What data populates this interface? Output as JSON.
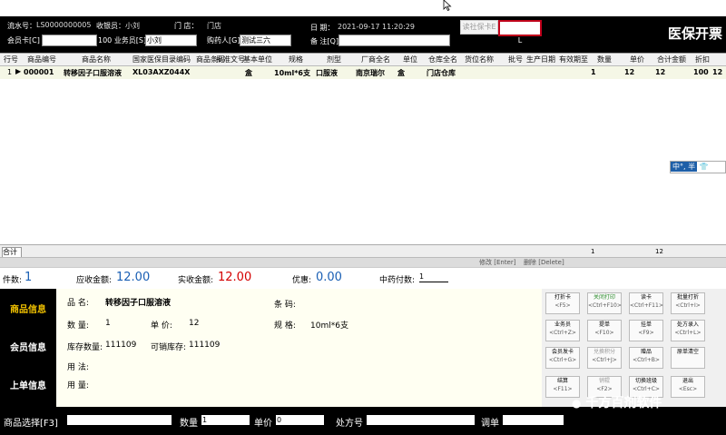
{
  "header": {
    "serial_label": "流水号：",
    "serial_value": "LS0000000005",
    "cashier_label": "收银员：",
    "cashier_value": "小刘",
    "store_label": "门  店：",
    "store_value": "门店",
    "date_label": "日  期：",
    "date_value": "2021-09-17 11:20:29",
    "member_label": "会员卡[C]",
    "member_value": "",
    "staff_label": "100 业务员[S]",
    "staff_value": "小刘",
    "buyer_label": "购药人[G]",
    "buyer_value": "测试三六",
    "note_label": "备  注[Q]",
    "note_value": "",
    "read_card_btn": "读社保卡E",
    "clear_card_btn": "清除社保卡L",
    "page_title": "医保开票"
  },
  "grid": {
    "columns": [
      "行号",
      "商品编号",
      "商品名称",
      "国家医保目录编码",
      "商品条码",
      "批准文号",
      "基本单位",
      "规格",
      "剂型",
      "厂商全名",
      "单位",
      "仓库全名",
      "货位名称",
      "批号",
      "生产日期",
      "有效期至",
      "数量",
      "单价",
      "合计金额",
      "折扣"
    ],
    "rows": [
      {
        "line": "1",
        "code": "000001",
        "name": "转移因子口服溶液",
        "insurance_code": "XL03AXZ044X",
        "unit_basic": "盒",
        "spec": "10ml*6支",
        "form": "口服液",
        "maker": "南京瑞尔",
        "unit": "盒",
        "warehouse": "门店仓库",
        "qty": "1",
        "price": "12",
        "total": "12",
        "discount": "100",
        "extra": "12"
      }
    ],
    "sum_label": "合计",
    "sum_qty": "1",
    "sum_total": "12",
    "modify_label": "修改 [Enter]",
    "delete_label": "删除 [Delete]",
    "ime_text": "中°, 半"
  },
  "totals": {
    "count_label": "件数:",
    "count_value": "1",
    "receivable_label": "应收金额:",
    "receivable_value": "12.00",
    "received_label": "实收金额:",
    "received_value": "12.00",
    "discount_label": "优惠:",
    "discount_value": "0.00",
    "herb_label": "中药付数:",
    "herb_value": "1"
  },
  "side_tabs": [
    "商品信息",
    "会员信息",
    "上单信息"
  ],
  "info": {
    "name_label": "品    名:",
    "name_value": "转移因子口服溶液",
    "barcode_label": "条    码:",
    "barcode_value": "",
    "qty_label": "数    量:",
    "qty_value": "1",
    "price_label": "单    价:",
    "price_value": "12",
    "spec_label": "规    格:",
    "spec_value": "10ml*6支",
    "stock_label": "库存数量:",
    "stock_value": "111109",
    "sellable_label": "可销库存:",
    "sellable_value": "111109",
    "usage_label": "用    法:",
    "dosage_label": "用    量:"
  },
  "buttons": [
    {
      "label": "打折卡",
      "key": "<F5>"
    },
    {
      "label": "关闭打印",
      "key": "<Ctrl+F10>"
    },
    {
      "label": "读卡",
      "key": "<Ctrl+F11>"
    },
    {
      "label": "批量打折",
      "key": "<Ctrl+I>"
    },
    {
      "label": "业务员",
      "key": "<Ctrl+Z>"
    },
    {
      "label": "提单",
      "key": "<F10>"
    },
    {
      "label": "挂单",
      "key": "<F9>"
    },
    {
      "label": "处方录入",
      "key": "<Ctrl+L>"
    },
    {
      "label": "会员发卡",
      "key": "<Ctrl+G>"
    },
    {
      "label": "兑换积分",
      "key": "<Ctrl+J>"
    },
    {
      "label": "赠品",
      "key": "<Ctrl+B>"
    },
    {
      "label": "原单清空",
      "key": ""
    },
    {
      "label": "结算",
      "key": "<F11>"
    },
    {
      "label": "销辊",
      "key": "<F2>"
    },
    {
      "label": "切换班级",
      "key": "<Ctrl+C>"
    },
    {
      "label": "退出",
      "key": "<Esc>"
    }
  ],
  "bottom": {
    "product_label": "商品选择[F3]",
    "product_value": "",
    "qty_label": "数量",
    "qty_value": "1",
    "price_label": "单价",
    "price_value": "0",
    "rx_label": "处方号",
    "rx_value": "",
    "bill_label": "调单",
    "bill_value": ""
  },
  "watermark": "千方百剂软件"
}
